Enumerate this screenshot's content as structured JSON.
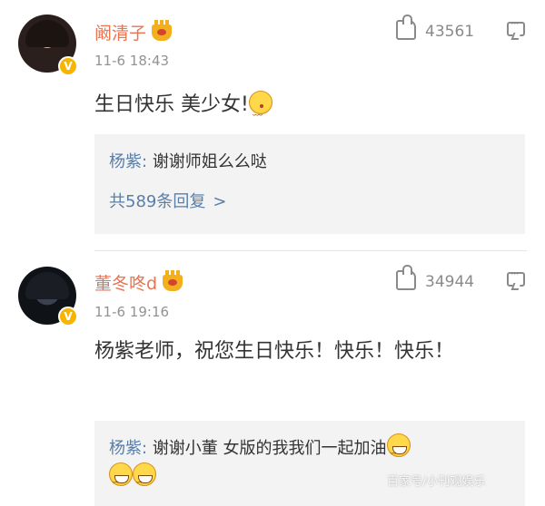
{
  "comments": [
    {
      "username": "阚清子",
      "time": "11-6 18:43",
      "likes": "43561",
      "text": "生日快乐 美少女!",
      "text_emoji": "kiss-emoji",
      "reply": {
        "user": "杨紫:",
        "text": "谢谢师姐么么哒",
        "more_label": "共589条回复",
        "more_chevron": ">"
      }
    },
    {
      "username": "董冬咚d",
      "time": "11-6 19:16",
      "likes": "34944",
      "text": "杨紫老师，祝您生日快乐！快乐！快乐！",
      "reply": {
        "user": "杨紫:",
        "text": "谢谢小董 女版的我我们一起加油",
        "emojis": [
          "grin-emoji",
          "grin-emoji",
          "grin-emoji"
        ]
      }
    }
  ],
  "badge_icon": "verified-v-icon",
  "vip_icon": "crown-icon",
  "colors": {
    "username": "#eb7350",
    "link": "#5a7ea8",
    "meta": "#939393",
    "reply_bg": "#f3f3f3",
    "verified": "#f7b500"
  },
  "watermark": "百家号/小刊观娱乐"
}
